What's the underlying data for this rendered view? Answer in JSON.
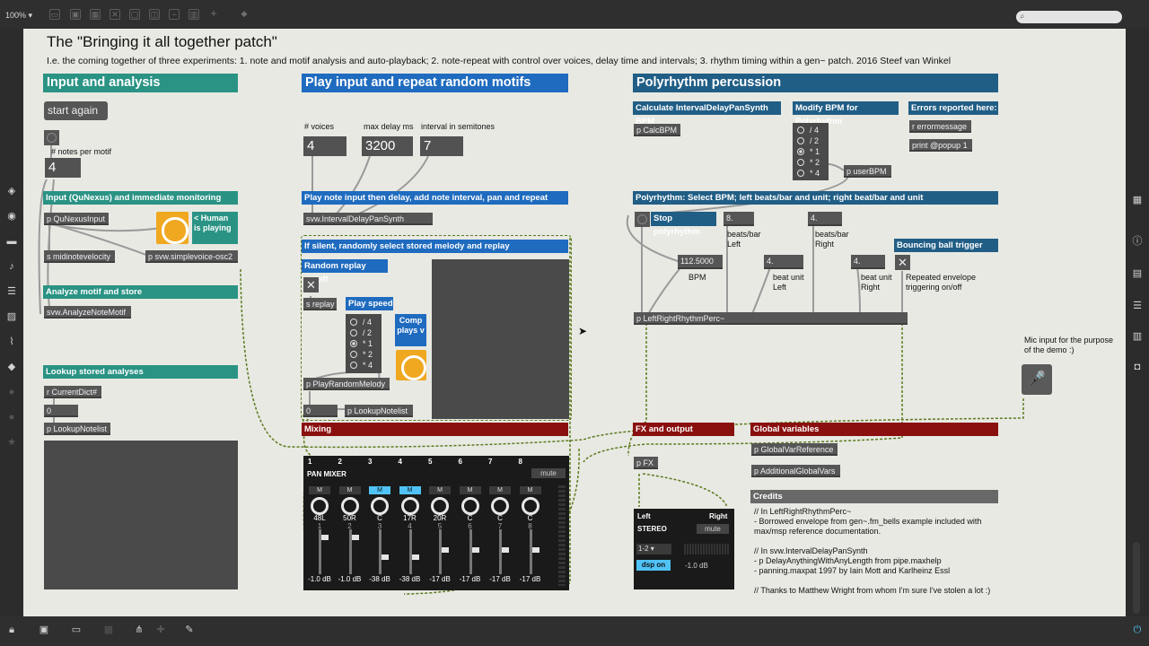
{
  "toolbar": {
    "zoom": "100% ▾",
    "search_icon": "⌕"
  },
  "title": "The \"Bringing it all together patch\"",
  "subtitle": "I.e. the coming together of three experiments: 1. note and motif analysis and auto-playback; 2. note-repeat with control over voices, delay time and intervals; 3. rhythm timing within a gen~ patch. 2016 Steef van Winkel",
  "input": {
    "header": "Input and analysis",
    "start_again": "start again",
    "notes_per_motif_label": "# notes per motif",
    "notes_per_motif": "4",
    "monitor_bar": "Input (QuNexus) and immediate monitoring",
    "qunexus": "p QuNexusInput",
    "human_label": "< Human is playing",
    "midinotevelocity": "s midinotevelocity",
    "simplevoice": "p svw.simplevoice-osc2",
    "analyze_bar": "Analyze motif and store",
    "analyzenote": "svw.AnalyzeNoteMotif",
    "lookup_bar": "Lookup stored analyses",
    "currentdict": "r CurrentDict#",
    "zero": "0",
    "lookupnotelist": "p LookupNotelist"
  },
  "play": {
    "header": "Play input and repeat random motifs",
    "voices_label": "# voices",
    "voices": "4",
    "delay_label": "max delay ms",
    "delay": "3200",
    "interval_label": "interval in semitones",
    "interval": "7",
    "delay_bar": "Play note input then delay, add note interval, pan and repeat",
    "interval_delay": "svw.IntervalDelayPanSynth",
    "silent_bar": "If silent, randomly select stored melody and replay",
    "random_bar": "Random replay on/off",
    "sreplay": "s replay",
    "speed_bar": "Play speed",
    "speed_options": [
      "/ 4",
      "/ 2",
      "* 1",
      "* 2",
      "* 4"
    ],
    "comp_plays": "Comp plays v",
    "playrandom": "p PlayRandomMelody",
    "zero": "0",
    "lookupnotelist": "p LookupNotelist",
    "mixing_bar": "Mixing"
  },
  "mixer": {
    "title": "PAN MIXER",
    "mute": "mute",
    "channels": [
      {
        "num": "1",
        "pan": "48L",
        "idx": "1",
        "db": "-1.0 dB",
        "solo": false
      },
      {
        "num": "2",
        "pan": "50R",
        "idx": "2",
        "db": "-1.0 dB",
        "solo": false
      },
      {
        "num": "3",
        "pan": "C",
        "idx": "3",
        "db": "-38 dB",
        "solo": true
      },
      {
        "num": "4",
        "pan": "17R",
        "idx": "4",
        "db": "-38 dB",
        "solo": true
      },
      {
        "num": "5",
        "pan": "20R",
        "idx": "5",
        "db": "-17 dB",
        "solo": false
      },
      {
        "num": "6",
        "pan": "C",
        "idx": "6",
        "db": "-17 dB",
        "solo": false
      },
      {
        "num": "7",
        "pan": "C",
        "idx": "7",
        "db": "-17 dB",
        "solo": false
      },
      {
        "num": "8",
        "pan": "C",
        "idx": "8",
        "db": "-17 dB",
        "solo": false
      }
    ],
    "m_label": "M"
  },
  "poly": {
    "header": "Polyrhythm percussion",
    "calc_bar": "Calculate IntervalDelayPanSynth BPM",
    "calcbpm": "p CalcBPM",
    "modify_bar": "Modify BPM for Polyrhythm",
    "bpm_options": [
      "/ 4",
      "/ 2",
      "* 1",
      "* 2",
      "* 4"
    ],
    "userbpm": "p userBPM",
    "errors_bar": "Errors reported here:",
    "errormessage": "r errormessage",
    "printpopup": "print @popup 1",
    "select_bar": "Polyrhythm: Select BPM; left beats/bar and unit; right beat/bar and unit",
    "stop_label": "Stop polyrhythm",
    "bpm_value": "112.5000",
    "bpm_label": "BPM",
    "beats_left": "8.",
    "beats_left_label": "beats/bar Left",
    "unit_left": "4.",
    "unit_left_label": "beat unit Left",
    "beats_right": "4.",
    "beats_right_label": "beats/bar Right",
    "unit_right": "4.",
    "unit_right_label": "beat unit Right",
    "bounce_bar": "Bouncing ball trigger",
    "bounce_label": "Repeated envelope triggering on/off",
    "leftright": "p LeftRightRhythmPerc~"
  },
  "fx": {
    "bar": "FX and output",
    "pfx": "p FX",
    "left": "Left",
    "right": "Right",
    "stereo": "STEREO",
    "mute": "mute",
    "route": "1-2 ▾",
    "dsp": "dsp on",
    "db": "-1.0 dB"
  },
  "globals": {
    "bar": "Global variables",
    "ref": "p GlobalVarReference",
    "additional": "p AdditionalGlobalVars"
  },
  "credits": {
    "bar": "Credits",
    "lines": [
      "// In LeftRightRhythmPerc~",
      "- Borrowed envelope from gen~.fm_bells example included with",
      "max/msp reference documentation.",
      "",
      "// In svw.IntervalDelayPanSynth",
      "- p DelayAnythingWithAnyLength from pipe.maxhelp",
      "- panning.maxpat 1997 by Iain Mott and Karlheinz Essl",
      "",
      "// Thanks to Matthew Wright from whom I'm sure I've stolen a lot :)"
    ]
  },
  "mic": {
    "label": "Mic input for the purpose of the demo :)",
    "icon": "🎤"
  },
  "colors": {
    "teal": "#2a9384",
    "blue": "#1f6bbf",
    "navy": "#215e86",
    "red": "#8a1010",
    "orange": "#f0a820",
    "cyan": "#4fc3f7"
  }
}
